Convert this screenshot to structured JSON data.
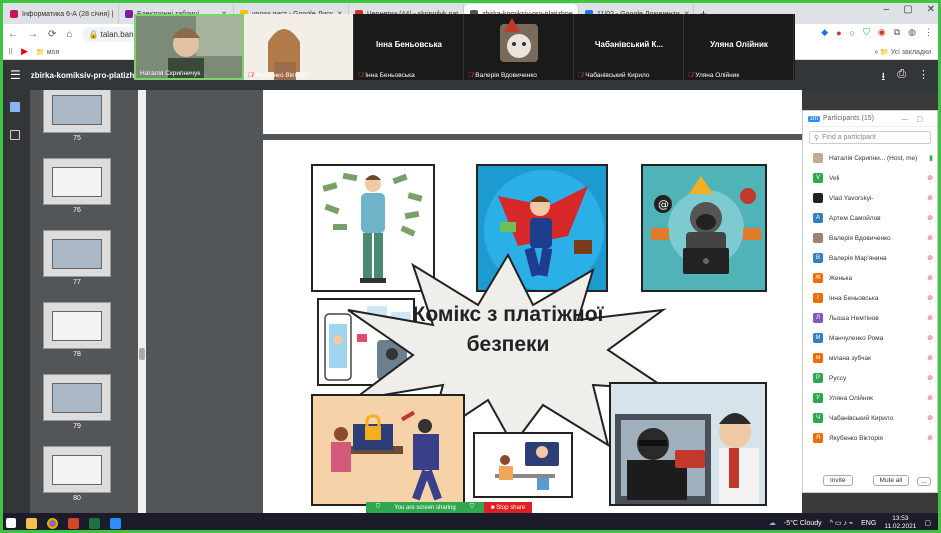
{
  "browser": {
    "tabs": [
      {
        "label": "Інформатика 6-А (28 січня) |",
        "color": "#c2185b",
        "active": false
      },
      {
        "label": "Електронні таблиці",
        "color": "#7b1fa2",
        "active": false
      },
      {
        "label": "уроки дист - Google Диск",
        "color": "#fbbc04",
        "active": false
      },
      {
        "label": "Чернетки (44) - skripnilyk.nat",
        "color": "#d93025",
        "active": false
      },
      {
        "label": "zbirka-komiksiv-pro-platizhne",
        "color": "#555555",
        "active": true
      },
      {
        "label": "11/02 - Google Документи",
        "color": "#1a73e8",
        "active": false
      }
    ],
    "new_tab": "+",
    "url": "talan.bank.gov",
    "bookmarks_folder": "моя",
    "all_bookmarks": "Усі закладки"
  },
  "pdf": {
    "title": "zbirka-komiksiv-pro-platizhne-sh",
    "thumbs": [
      {
        "num": "75"
      },
      {
        "num": "76"
      },
      {
        "num": "77"
      },
      {
        "num": "78"
      },
      {
        "num": "79"
      },
      {
        "num": "80"
      }
    ],
    "burst_line1": "Комікс з платіжної",
    "burst_line2": "безпеки"
  },
  "video": {
    "tiles": [
      {
        "name": "Наталія Скрипничук",
        "big": "",
        "muted": false,
        "active": true,
        "type": "cam"
      },
      {
        "name": "Якубенко Вікторія",
        "big": "",
        "muted": true,
        "active": false,
        "type": "cam2"
      },
      {
        "name": "Інна Беньовська",
        "big": "Інна Беньовська",
        "muted": true,
        "active": false,
        "type": "name"
      },
      {
        "name": "Валерія Вдовиченко",
        "big": "",
        "muted": true,
        "active": false,
        "type": "cat"
      },
      {
        "name": "Чабанівський Кирило",
        "big": "Чабанівський К...",
        "muted": true,
        "active": false,
        "type": "name"
      },
      {
        "name": "Уляна Олійник",
        "big": "Уляна Олійник",
        "muted": true,
        "active": false,
        "type": "name"
      }
    ]
  },
  "participants": {
    "header": "Participants (15)",
    "search_placeholder": "Find a participant",
    "list": [
      {
        "initial": "",
        "name": "Наталія Скрипни... (Host, me)",
        "color": "#c8a890",
        "muted": false
      },
      {
        "initial": "V",
        "name": "Veli",
        "color": "#2ea84f",
        "muted": true
      },
      {
        "initial": "",
        "name": "Vlad Yavorskyi-",
        "color": "#222222",
        "muted": true
      },
      {
        "initial": "А",
        "name": "Артем Самойлов",
        "color": "#2f7fc1",
        "muted": true
      },
      {
        "initial": "",
        "name": "Валерія Вдовиченко",
        "color": "#a08070",
        "muted": true
      },
      {
        "initial": "В",
        "name": "Валерія Мар'янина",
        "color": "#2f7fc1",
        "muted": true
      },
      {
        "initial": "Ж",
        "name": "Женька",
        "color": "#ef6c00",
        "muted": true
      },
      {
        "initial": "І",
        "name": "Інна Беньовська",
        "color": "#ef6c00",
        "muted": true
      },
      {
        "initial": "Л",
        "name": "Льоша Немтінов",
        "color": "#7e57c2",
        "muted": true
      },
      {
        "initial": "М",
        "name": "Манчуленко Рома",
        "color": "#2f7fc1",
        "muted": true
      },
      {
        "initial": "м",
        "name": "мілана зубчак",
        "color": "#ef6c00",
        "muted": true
      },
      {
        "initial": "Р",
        "name": "Руссу",
        "color": "#2ea84f",
        "muted": true
      },
      {
        "initial": "У",
        "name": "Уляна Олійник",
        "color": "#2ea84f",
        "muted": true
      },
      {
        "initial": "Ч",
        "name": "Чабанівський Кирило",
        "color": "#2ea84f",
        "muted": true
      },
      {
        "initial": "Я",
        "name": "Якубенко Вікторія",
        "color": "#ef6c00",
        "muted": true
      }
    ],
    "invite": "Invite",
    "mute_all": "Mute all",
    "more": "..."
  },
  "share": {
    "status": "You are screen sharing",
    "stop": "Stop share"
  },
  "taskbar": {
    "weather": "-5°C  Cloudy",
    "lang": "ENG",
    "time": "13:53",
    "date": "11.02.2021"
  }
}
